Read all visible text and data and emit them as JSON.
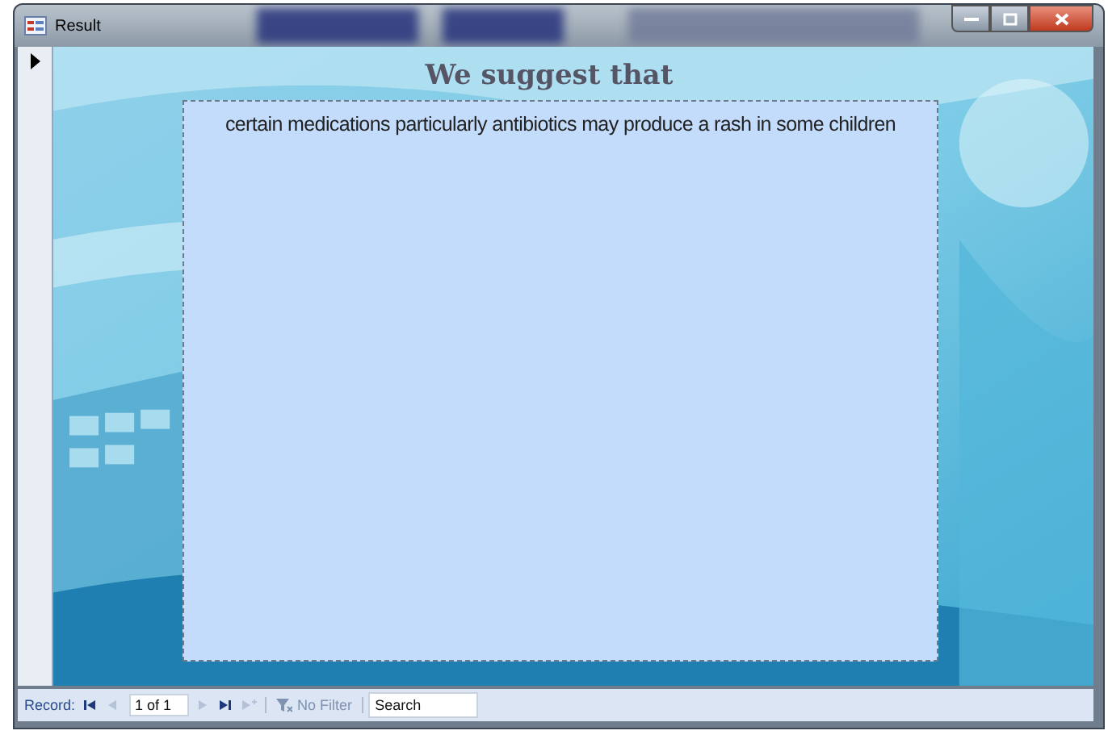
{
  "window": {
    "title": "Result"
  },
  "form": {
    "heading": "We suggest that",
    "text_box": {
      "value": "certain medications particularly antibiotics may produce a rash in some children"
    }
  },
  "navigation": {
    "record_label": "Record:",
    "buttons": [
      {
        "kind": "first",
        "disabled": false
      },
      {
        "kind": "prev",
        "disabled": true
      }
    ],
    "position": "1 of 1",
    "buttons_after": [
      {
        "kind": "next",
        "disabled": true
      },
      {
        "kind": "last",
        "disabled": false
      },
      {
        "kind": "new",
        "disabled": true
      }
    ],
    "filter": {
      "label": "No Filter",
      "disabled": true
    },
    "search": {
      "placeholder": "Search"
    }
  }
}
